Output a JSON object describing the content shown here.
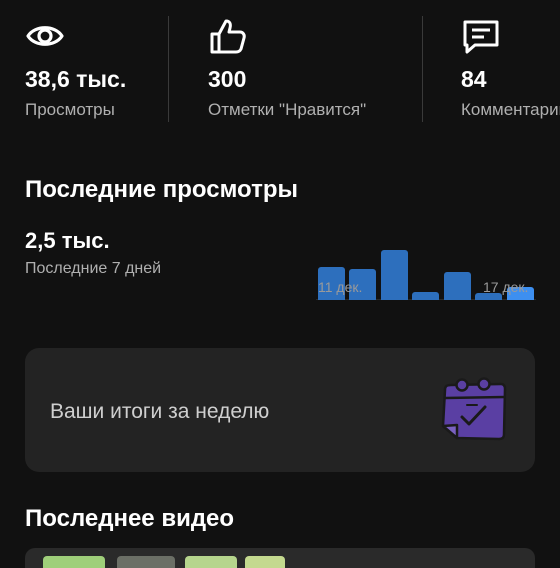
{
  "stats": [
    {
      "value": "38,6 тыс.",
      "label": "Просмотры",
      "icon": "eye-icon"
    },
    {
      "value": "300",
      "label": "Отметки \"Нравится\"",
      "icon": "thumbs-up-icon"
    },
    {
      "value": "84",
      "label": "Комментарии",
      "icon": "comment-icon"
    }
  ],
  "recent": {
    "title": "Последние просмотры",
    "value": "2,5 тыс.",
    "period": "Последние 7 дней"
  },
  "chart_data": {
    "type": "bar",
    "categories": [
      "11 дек.",
      "",
      "",
      "",
      "",
      "",
      "17 дек."
    ],
    "values": [
      33,
      31,
      50,
      8,
      28,
      7,
      13
    ],
    "ylim": [
      0,
      50
    ],
    "tick_labels": [
      "11 дек.",
      "17 дек."
    ],
    "colors": {
      "bar": "#2d6fbd",
      "highlight": "#3d8ff0"
    }
  },
  "weekly": {
    "text": "Ваши итоги за неделю",
    "icon": "calendar-check-icon"
  },
  "latest": {
    "title": "Последнее видео"
  },
  "colors": {
    "background": "#111111",
    "card": "#232323",
    "accent_purple": "#5a3fa3"
  }
}
